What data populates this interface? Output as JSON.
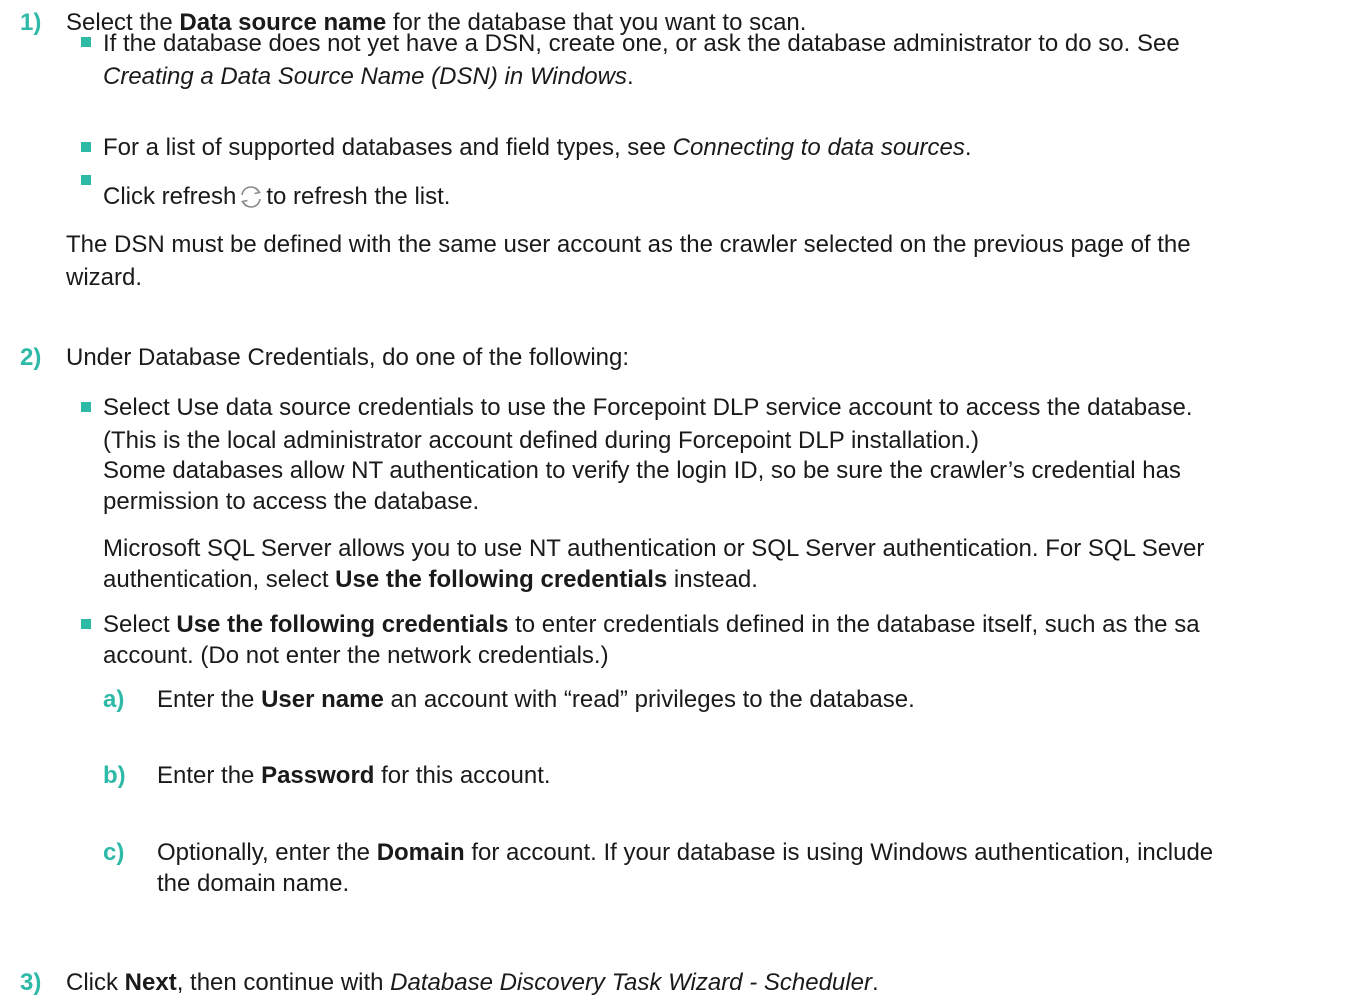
{
  "colors": {
    "accent": "#2fb9a7",
    "text": "#1a1a1a"
  },
  "step1": {
    "num": "1)",
    "pre": "Select the ",
    "b": "Data source name",
    "post": " for the database that you want to scan.",
    "bullet1": {
      "l1": "If the database does not yet have a DSN, create one, or ask the database administrator to do so. See",
      "l2_i": "Creating a Data Source Name (DSN) in Windows",
      "l2_post": "."
    },
    "bullet2": {
      "pre": "For a list of supported databases and field types, see ",
      "i": "Connecting to data sources",
      "post": "."
    },
    "bullet3": {
      "pre": "Click refresh",
      "icon": "refresh-icon",
      "post": "to refresh the list."
    },
    "note_l1": "The DSN must be defined with the same user account as the crawler selected on the previous page of the",
    "note_l2": "wizard."
  },
  "step2": {
    "num": "2)",
    "text": "Under Database Credentials, do one of the following:",
    "bullet1": {
      "l1": "Select Use data source credentials to use the Forcepoint DLP service account to access the database.",
      "l2": "(This is the local administrator account defined during Forcepoint DLP installation.)",
      "l3": "Some databases allow NT authentication to verify the login ID, so be sure the crawler’s credential has",
      "l4": "permission to access the database.",
      "p2_l1": "Microsoft SQL Server allows you to use NT authentication or SQL Server authentication. For SQL Sever",
      "p2_l2_pre": "authentication, select ",
      "p2_l2_b": "Use the following credentials",
      "p2_l2_post": " instead."
    },
    "bullet2": {
      "l1_pre": "Select ",
      "l1_b": "Use the following credentials",
      "l1_post": " to enter credentials defined in the database itself, such as the sa",
      "l2": "account. (Do not enter the network credentials.)"
    },
    "sub_a": {
      "letter": "a)",
      "pre": "Enter the ",
      "b": "User name",
      "post": " an account with “read” privileges to the database."
    },
    "sub_b": {
      "letter": "b)",
      "pre": "Enter the ",
      "b": "Password",
      "post": " for this account."
    },
    "sub_c": {
      "letter": "c)",
      "l1_pre": "Optionally, enter the ",
      "l1_b": "Domain",
      "l1_post": " for account. If your database is using Windows authentication, include",
      "l2": "the domain name."
    }
  },
  "step3": {
    "num": "3)",
    "pre": "Click ",
    "b": "Next",
    "mid": ", then continue with ",
    "i": "Database Discovery Task Wizard - Scheduler",
    "post": "."
  }
}
